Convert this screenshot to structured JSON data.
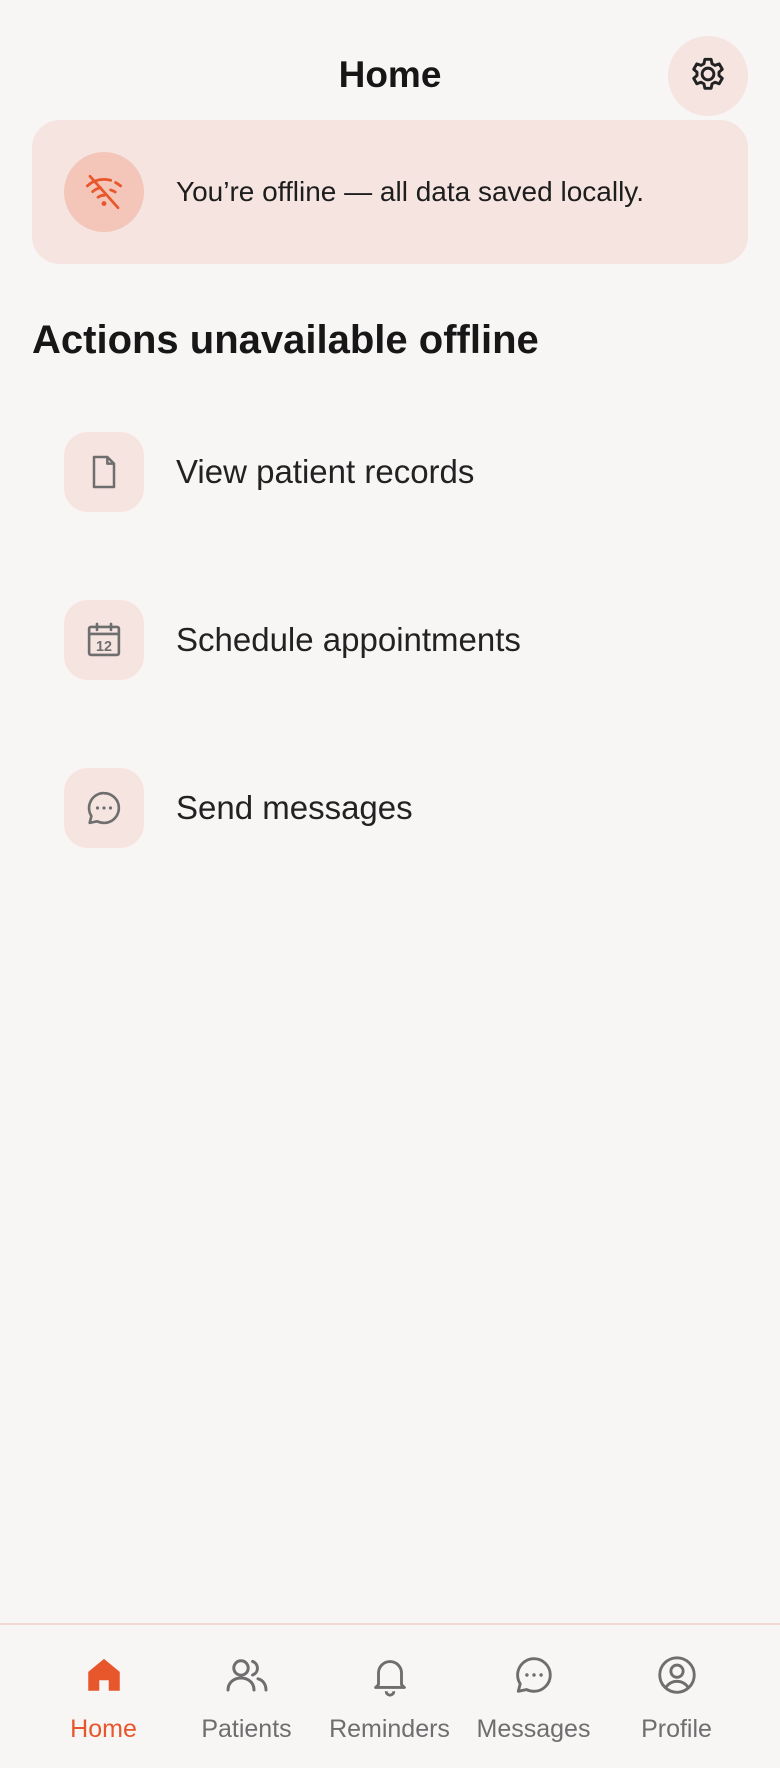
{
  "header": {
    "title": "Home",
    "settings_icon": "gear-icon"
  },
  "banner": {
    "icon": "wifi-off-icon",
    "text": "You’re offline — all data saved locally."
  },
  "section": {
    "title": "Actions unavailable offline",
    "items": [
      {
        "label": "View patient records",
        "icon": "document-icon"
      },
      {
        "label": "Schedule appointments",
        "icon": "calendar-icon",
        "icon_text": "12"
      },
      {
        "label": "Send messages",
        "icon": "chat-bubble-icon"
      }
    ]
  },
  "nav": {
    "items": [
      {
        "label": "Home",
        "icon": "home-icon",
        "active": true
      },
      {
        "label": "Patients",
        "icon": "people-icon",
        "active": false
      },
      {
        "label": "Reminders",
        "icon": "bell-icon",
        "active": false
      },
      {
        "label": "Messages",
        "icon": "chat-bubble-icon",
        "active": false
      },
      {
        "label": "Profile",
        "icon": "user-circle-icon",
        "active": false
      }
    ]
  },
  "colors": {
    "accent": "#e8572c",
    "background": "#f8f5f5",
    "tint": "#f5e4e0",
    "icon_gray": "#6e6e6e"
  }
}
